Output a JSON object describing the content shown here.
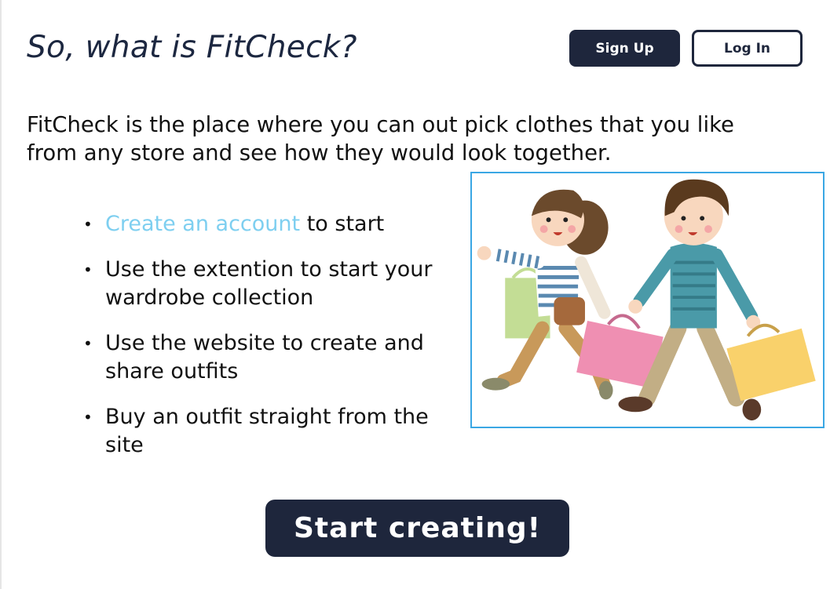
{
  "header": {
    "title": "So, what is FitCheck?",
    "signup_label": "Sign Up",
    "login_label": "Log In"
  },
  "intro": {
    "text": "FitCheck is the place where you can out pick clothes that you like from any store and see how they would look together."
  },
  "steps": {
    "items": [
      {
        "link": "Create an account",
        "text": " to start"
      },
      {
        "link": "",
        "text": "Use the extention to start your wardrobe collection"
      },
      {
        "link": "",
        "text": "Use the website to create and share outfits"
      },
      {
        "link": "",
        "text": "Buy an outfit straight from the site"
      }
    ]
  },
  "illustration": {
    "icon": "shopping-couple-illustration"
  },
  "cta": {
    "label": "Start creating!"
  },
  "colors": {
    "primary_dark": "#1e263c",
    "link": "#7ecff0",
    "title": "#1c2740",
    "image_border": "#3aa7e4"
  }
}
